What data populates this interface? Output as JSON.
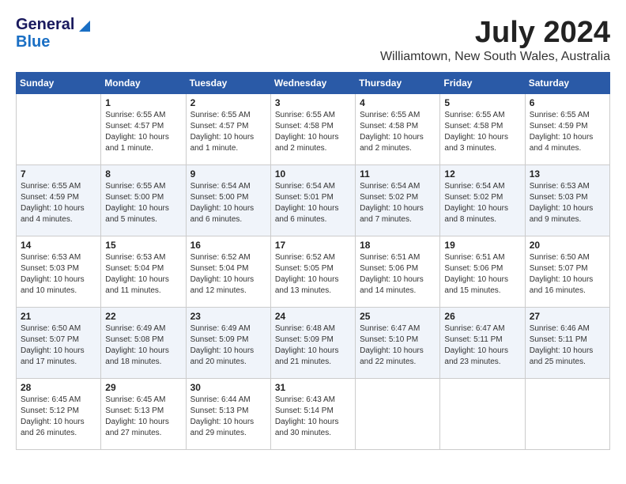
{
  "header": {
    "logo_line1": "General",
    "logo_line2": "Blue",
    "month_title": "July 2024",
    "location": "Williamtown, New South Wales, Australia"
  },
  "calendar": {
    "days_of_week": [
      "Sunday",
      "Monday",
      "Tuesday",
      "Wednesday",
      "Thursday",
      "Friday",
      "Saturday"
    ],
    "weeks": [
      [
        {
          "day": "",
          "info": ""
        },
        {
          "day": "1",
          "info": "Sunrise: 6:55 AM\nSunset: 4:57 PM\nDaylight: 10 hours\nand 1 minute."
        },
        {
          "day": "2",
          "info": "Sunrise: 6:55 AM\nSunset: 4:57 PM\nDaylight: 10 hours\nand 1 minute."
        },
        {
          "day": "3",
          "info": "Sunrise: 6:55 AM\nSunset: 4:58 PM\nDaylight: 10 hours\nand 2 minutes."
        },
        {
          "day": "4",
          "info": "Sunrise: 6:55 AM\nSunset: 4:58 PM\nDaylight: 10 hours\nand 2 minutes."
        },
        {
          "day": "5",
          "info": "Sunrise: 6:55 AM\nSunset: 4:58 PM\nDaylight: 10 hours\nand 3 minutes."
        },
        {
          "day": "6",
          "info": "Sunrise: 6:55 AM\nSunset: 4:59 PM\nDaylight: 10 hours\nand 4 minutes."
        }
      ],
      [
        {
          "day": "7",
          "info": "Sunrise: 6:55 AM\nSunset: 4:59 PM\nDaylight: 10 hours\nand 4 minutes."
        },
        {
          "day": "8",
          "info": "Sunrise: 6:55 AM\nSunset: 5:00 PM\nDaylight: 10 hours\nand 5 minutes."
        },
        {
          "day": "9",
          "info": "Sunrise: 6:54 AM\nSunset: 5:00 PM\nDaylight: 10 hours\nand 6 minutes."
        },
        {
          "day": "10",
          "info": "Sunrise: 6:54 AM\nSunset: 5:01 PM\nDaylight: 10 hours\nand 6 minutes."
        },
        {
          "day": "11",
          "info": "Sunrise: 6:54 AM\nSunset: 5:02 PM\nDaylight: 10 hours\nand 7 minutes."
        },
        {
          "day": "12",
          "info": "Sunrise: 6:54 AM\nSunset: 5:02 PM\nDaylight: 10 hours\nand 8 minutes."
        },
        {
          "day": "13",
          "info": "Sunrise: 6:53 AM\nSunset: 5:03 PM\nDaylight: 10 hours\nand 9 minutes."
        }
      ],
      [
        {
          "day": "14",
          "info": "Sunrise: 6:53 AM\nSunset: 5:03 PM\nDaylight: 10 hours\nand 10 minutes."
        },
        {
          "day": "15",
          "info": "Sunrise: 6:53 AM\nSunset: 5:04 PM\nDaylight: 10 hours\nand 11 minutes."
        },
        {
          "day": "16",
          "info": "Sunrise: 6:52 AM\nSunset: 5:04 PM\nDaylight: 10 hours\nand 12 minutes."
        },
        {
          "day": "17",
          "info": "Sunrise: 6:52 AM\nSunset: 5:05 PM\nDaylight: 10 hours\nand 13 minutes."
        },
        {
          "day": "18",
          "info": "Sunrise: 6:51 AM\nSunset: 5:06 PM\nDaylight: 10 hours\nand 14 minutes."
        },
        {
          "day": "19",
          "info": "Sunrise: 6:51 AM\nSunset: 5:06 PM\nDaylight: 10 hours\nand 15 minutes."
        },
        {
          "day": "20",
          "info": "Sunrise: 6:50 AM\nSunset: 5:07 PM\nDaylight: 10 hours\nand 16 minutes."
        }
      ],
      [
        {
          "day": "21",
          "info": "Sunrise: 6:50 AM\nSunset: 5:07 PM\nDaylight: 10 hours\nand 17 minutes."
        },
        {
          "day": "22",
          "info": "Sunrise: 6:49 AM\nSunset: 5:08 PM\nDaylight: 10 hours\nand 18 minutes."
        },
        {
          "day": "23",
          "info": "Sunrise: 6:49 AM\nSunset: 5:09 PM\nDaylight: 10 hours\nand 20 minutes."
        },
        {
          "day": "24",
          "info": "Sunrise: 6:48 AM\nSunset: 5:09 PM\nDaylight: 10 hours\nand 21 minutes."
        },
        {
          "day": "25",
          "info": "Sunrise: 6:47 AM\nSunset: 5:10 PM\nDaylight: 10 hours\nand 22 minutes."
        },
        {
          "day": "26",
          "info": "Sunrise: 6:47 AM\nSunset: 5:11 PM\nDaylight: 10 hours\nand 23 minutes."
        },
        {
          "day": "27",
          "info": "Sunrise: 6:46 AM\nSunset: 5:11 PM\nDaylight: 10 hours\nand 25 minutes."
        }
      ],
      [
        {
          "day": "28",
          "info": "Sunrise: 6:45 AM\nSunset: 5:12 PM\nDaylight: 10 hours\nand 26 minutes."
        },
        {
          "day": "29",
          "info": "Sunrise: 6:45 AM\nSunset: 5:13 PM\nDaylight: 10 hours\nand 27 minutes."
        },
        {
          "day": "30",
          "info": "Sunrise: 6:44 AM\nSunset: 5:13 PM\nDaylight: 10 hours\nand 29 minutes."
        },
        {
          "day": "31",
          "info": "Sunrise: 6:43 AM\nSunset: 5:14 PM\nDaylight: 10 hours\nand 30 minutes."
        },
        {
          "day": "",
          "info": ""
        },
        {
          "day": "",
          "info": ""
        },
        {
          "day": "",
          "info": ""
        }
      ]
    ]
  }
}
